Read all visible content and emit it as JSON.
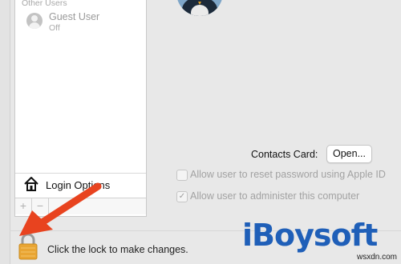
{
  "users_panel": {
    "section_label": "Other Users",
    "guest": {
      "name": "Guest User",
      "status": "Off"
    },
    "login_options_label": "Login Options",
    "add_label": "+",
    "remove_label": "−"
  },
  "details": {
    "contacts_card_label": "Contacts Card:",
    "open_button_label": "Open...",
    "reset_password_label": "Allow user to reset password using Apple ID",
    "reset_password_checked": false,
    "administer_label": "Allow user to administer this computer",
    "administer_checked": true
  },
  "footer": {
    "lock_text": "Click the lock to make changes."
  },
  "watermark": {
    "logo": "iBoysoft",
    "site": "wsxdn.com"
  },
  "colors": {
    "arrow": "#e8431f",
    "logo": "#1f5fb8",
    "lock_body": "#e9a533"
  }
}
